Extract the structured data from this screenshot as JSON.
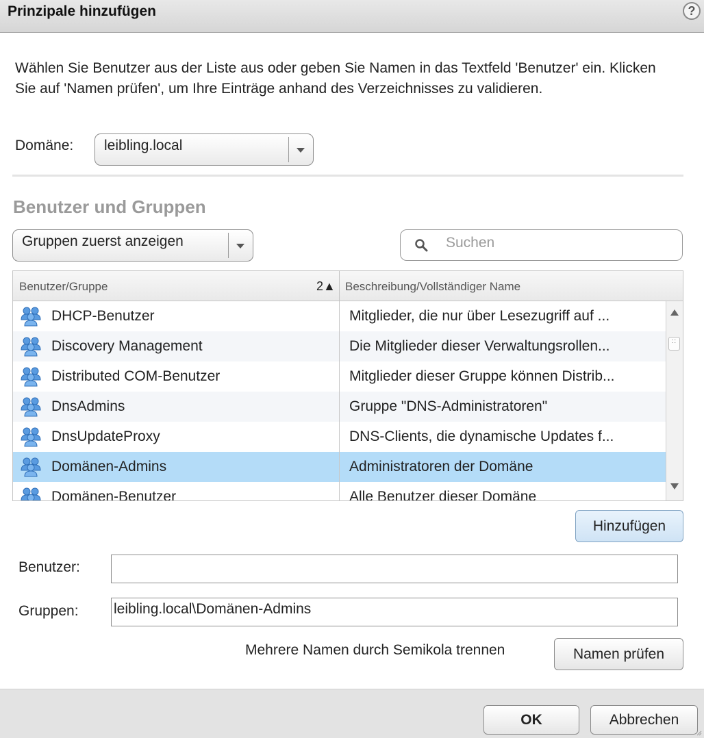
{
  "dialog": {
    "title": "Prinzipale hinzufügen",
    "help_icon": "?"
  },
  "intro_text": "Wählen Sie Benutzer aus der Liste aus oder geben Sie Namen in das Textfeld 'Benutzer' ein. Klicken Sie auf 'Namen prüfen', um Ihre Einträge anhand des Verzeichnisses zu validieren.",
  "domain": {
    "label": "Domäne:",
    "selected": "leibling.local"
  },
  "users_groups": {
    "section_title": "Benutzer und Gruppen",
    "filter_selected": "Gruppen zuerst anzeigen",
    "search_placeholder": "Suchen"
  },
  "table": {
    "columns": [
      {
        "label": "Benutzer/Gruppe",
        "sort_index": "2",
        "sort_dir": "▲"
      },
      {
        "label": "Beschreibung/Vollständiger Name"
      }
    ],
    "rows": [
      {
        "name": "DHCP-Benutzer",
        "description": "Mitglieder, die nur über Lesezugriff auf ...",
        "icon": "group-icon",
        "selected": false
      },
      {
        "name": "Discovery Management",
        "description": "Die Mitglieder dieser Verwaltungsrollen...",
        "icon": "group-icon",
        "selected": false
      },
      {
        "name": "Distributed COM-Benutzer",
        "description": "Mitglieder dieser Gruppe können Distrib...",
        "icon": "group-icon",
        "selected": false
      },
      {
        "name": "DnsAdmins",
        "description": "Gruppe \"DNS-Administratoren\"",
        "icon": "group-icon",
        "selected": false
      },
      {
        "name": "DnsUpdateProxy",
        "description": "DNS-Clients, die dynamische Updates f...",
        "icon": "group-icon",
        "selected": false
      },
      {
        "name": "Domänen-Admins",
        "description": "Administratoren der Domäne",
        "icon": "group-icon",
        "selected": true
      },
      {
        "name": "Domänen-Benutzer",
        "description": "Alle Benutzer dieser Domäne",
        "icon": "group-icon",
        "selected": false
      }
    ]
  },
  "add_button": "Hinzufügen",
  "users_field": {
    "label": "Benutzer:",
    "value": ""
  },
  "groups_field": {
    "label": "Gruppen:",
    "value": "leibling.local\\Domänen-Admins"
  },
  "hint_text": "Mehrere Namen durch Semikola trennen",
  "check_names_button": "Namen prüfen",
  "footer": {
    "ok": "OK",
    "cancel": "Abbrechen"
  },
  "colors": {
    "selected_row": "#b4dcf8",
    "group_icon": "#4a90d9",
    "section_title": "#9a9a9a"
  }
}
